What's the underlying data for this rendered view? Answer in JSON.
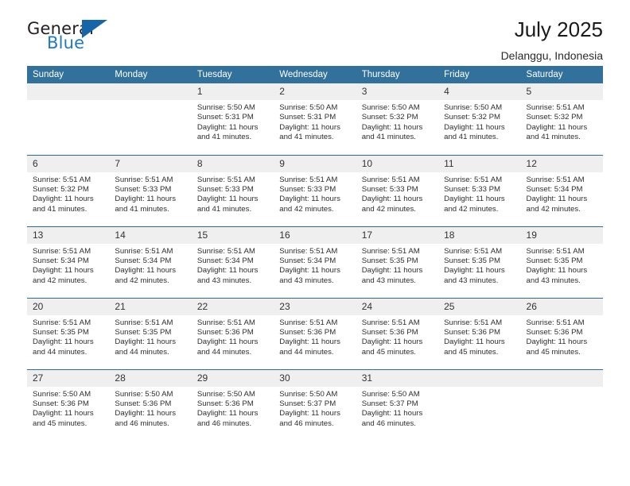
{
  "brand": {
    "name_top": "General",
    "name_bottom": "Blue",
    "triangle_icon": "brand-triangle-icon",
    "colors": {
      "dark": "#231f20",
      "blue": "#1f7ac4",
      "triangle": "#1565a8"
    }
  },
  "header": {
    "title": "July 2025",
    "location": "Delanggu, Indonesia"
  },
  "calendar": {
    "accent_color": "#31719c",
    "daynum_background": "#efefef",
    "weekday_headers": [
      "Sunday",
      "Monday",
      "Tuesday",
      "Wednesday",
      "Thursday",
      "Friday",
      "Saturday"
    ],
    "weeks": [
      [
        {
          "day": ""
        },
        {
          "day": ""
        },
        {
          "day": "1",
          "sunrise": "Sunrise: 5:50 AM",
          "sunset": "Sunset: 5:31 PM",
          "daylight_line1": "Daylight: 11 hours",
          "daylight_line2": "and 41 minutes."
        },
        {
          "day": "2",
          "sunrise": "Sunrise: 5:50 AM",
          "sunset": "Sunset: 5:31 PM",
          "daylight_line1": "Daylight: 11 hours",
          "daylight_line2": "and 41 minutes."
        },
        {
          "day": "3",
          "sunrise": "Sunrise: 5:50 AM",
          "sunset": "Sunset: 5:32 PM",
          "daylight_line1": "Daylight: 11 hours",
          "daylight_line2": "and 41 minutes."
        },
        {
          "day": "4",
          "sunrise": "Sunrise: 5:50 AM",
          "sunset": "Sunset: 5:32 PM",
          "daylight_line1": "Daylight: 11 hours",
          "daylight_line2": "and 41 minutes."
        },
        {
          "day": "5",
          "sunrise": "Sunrise: 5:51 AM",
          "sunset": "Sunset: 5:32 PM",
          "daylight_line1": "Daylight: 11 hours",
          "daylight_line2": "and 41 minutes."
        }
      ],
      [
        {
          "day": "6",
          "sunrise": "Sunrise: 5:51 AM",
          "sunset": "Sunset: 5:32 PM",
          "daylight_line1": "Daylight: 11 hours",
          "daylight_line2": "and 41 minutes."
        },
        {
          "day": "7",
          "sunrise": "Sunrise: 5:51 AM",
          "sunset": "Sunset: 5:33 PM",
          "daylight_line1": "Daylight: 11 hours",
          "daylight_line2": "and 41 minutes."
        },
        {
          "day": "8",
          "sunrise": "Sunrise: 5:51 AM",
          "sunset": "Sunset: 5:33 PM",
          "daylight_line1": "Daylight: 11 hours",
          "daylight_line2": "and 41 minutes."
        },
        {
          "day": "9",
          "sunrise": "Sunrise: 5:51 AM",
          "sunset": "Sunset: 5:33 PM",
          "daylight_line1": "Daylight: 11 hours",
          "daylight_line2": "and 42 minutes."
        },
        {
          "day": "10",
          "sunrise": "Sunrise: 5:51 AM",
          "sunset": "Sunset: 5:33 PM",
          "daylight_line1": "Daylight: 11 hours",
          "daylight_line2": "and 42 minutes."
        },
        {
          "day": "11",
          "sunrise": "Sunrise: 5:51 AM",
          "sunset": "Sunset: 5:33 PM",
          "daylight_line1": "Daylight: 11 hours",
          "daylight_line2": "and 42 minutes."
        },
        {
          "day": "12",
          "sunrise": "Sunrise: 5:51 AM",
          "sunset": "Sunset: 5:34 PM",
          "daylight_line1": "Daylight: 11 hours",
          "daylight_line2": "and 42 minutes."
        }
      ],
      [
        {
          "day": "13",
          "sunrise": "Sunrise: 5:51 AM",
          "sunset": "Sunset: 5:34 PM",
          "daylight_line1": "Daylight: 11 hours",
          "daylight_line2": "and 42 minutes."
        },
        {
          "day": "14",
          "sunrise": "Sunrise: 5:51 AM",
          "sunset": "Sunset: 5:34 PM",
          "daylight_line1": "Daylight: 11 hours",
          "daylight_line2": "and 42 minutes."
        },
        {
          "day": "15",
          "sunrise": "Sunrise: 5:51 AM",
          "sunset": "Sunset: 5:34 PM",
          "daylight_line1": "Daylight: 11 hours",
          "daylight_line2": "and 43 minutes."
        },
        {
          "day": "16",
          "sunrise": "Sunrise: 5:51 AM",
          "sunset": "Sunset: 5:34 PM",
          "daylight_line1": "Daylight: 11 hours",
          "daylight_line2": "and 43 minutes."
        },
        {
          "day": "17",
          "sunrise": "Sunrise: 5:51 AM",
          "sunset": "Sunset: 5:35 PM",
          "daylight_line1": "Daylight: 11 hours",
          "daylight_line2": "and 43 minutes."
        },
        {
          "day": "18",
          "sunrise": "Sunrise: 5:51 AM",
          "sunset": "Sunset: 5:35 PM",
          "daylight_line1": "Daylight: 11 hours",
          "daylight_line2": "and 43 minutes."
        },
        {
          "day": "19",
          "sunrise": "Sunrise: 5:51 AM",
          "sunset": "Sunset: 5:35 PM",
          "daylight_line1": "Daylight: 11 hours",
          "daylight_line2": "and 43 minutes."
        }
      ],
      [
        {
          "day": "20",
          "sunrise": "Sunrise: 5:51 AM",
          "sunset": "Sunset: 5:35 PM",
          "daylight_line1": "Daylight: 11 hours",
          "daylight_line2": "and 44 minutes."
        },
        {
          "day": "21",
          "sunrise": "Sunrise: 5:51 AM",
          "sunset": "Sunset: 5:35 PM",
          "daylight_line1": "Daylight: 11 hours",
          "daylight_line2": "and 44 minutes."
        },
        {
          "day": "22",
          "sunrise": "Sunrise: 5:51 AM",
          "sunset": "Sunset: 5:36 PM",
          "daylight_line1": "Daylight: 11 hours",
          "daylight_line2": "and 44 minutes."
        },
        {
          "day": "23",
          "sunrise": "Sunrise: 5:51 AM",
          "sunset": "Sunset: 5:36 PM",
          "daylight_line1": "Daylight: 11 hours",
          "daylight_line2": "and 44 minutes."
        },
        {
          "day": "24",
          "sunrise": "Sunrise: 5:51 AM",
          "sunset": "Sunset: 5:36 PM",
          "daylight_line1": "Daylight: 11 hours",
          "daylight_line2": "and 45 minutes."
        },
        {
          "day": "25",
          "sunrise": "Sunrise: 5:51 AM",
          "sunset": "Sunset: 5:36 PM",
          "daylight_line1": "Daylight: 11 hours",
          "daylight_line2": "and 45 minutes."
        },
        {
          "day": "26",
          "sunrise": "Sunrise: 5:51 AM",
          "sunset": "Sunset: 5:36 PM",
          "daylight_line1": "Daylight: 11 hours",
          "daylight_line2": "and 45 minutes."
        }
      ],
      [
        {
          "day": "27",
          "sunrise": "Sunrise: 5:50 AM",
          "sunset": "Sunset: 5:36 PM",
          "daylight_line1": "Daylight: 11 hours",
          "daylight_line2": "and 45 minutes."
        },
        {
          "day": "28",
          "sunrise": "Sunrise: 5:50 AM",
          "sunset": "Sunset: 5:36 PM",
          "daylight_line1": "Daylight: 11 hours",
          "daylight_line2": "and 46 minutes."
        },
        {
          "day": "29",
          "sunrise": "Sunrise: 5:50 AM",
          "sunset": "Sunset: 5:36 PM",
          "daylight_line1": "Daylight: 11 hours",
          "daylight_line2": "and 46 minutes."
        },
        {
          "day": "30",
          "sunrise": "Sunrise: 5:50 AM",
          "sunset": "Sunset: 5:37 PM",
          "daylight_line1": "Daylight: 11 hours",
          "daylight_line2": "and 46 minutes."
        },
        {
          "day": "31",
          "sunrise": "Sunrise: 5:50 AM",
          "sunset": "Sunset: 5:37 PM",
          "daylight_line1": "Daylight: 11 hours",
          "daylight_line2": "and 46 minutes."
        },
        {
          "day": ""
        },
        {
          "day": ""
        }
      ]
    ]
  }
}
